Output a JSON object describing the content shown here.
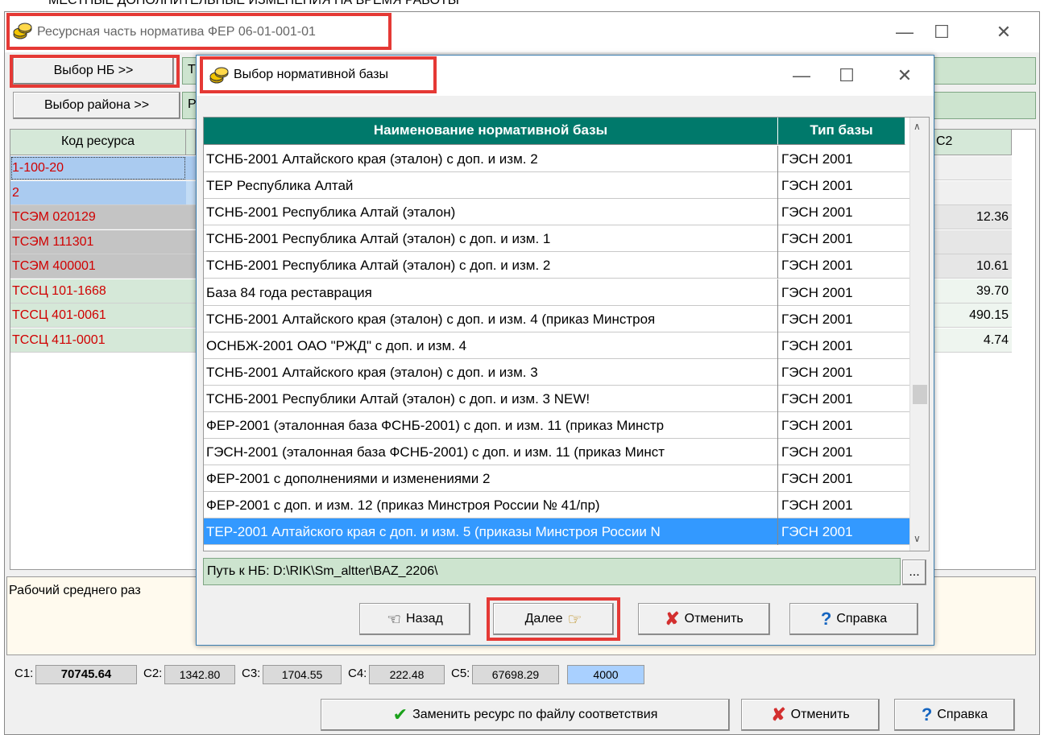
{
  "background_text": "МЕСТНЫЕ ДОПОЛНИТЕЛЬНЫЕ ИЗМЕНЕНИЯ НА ВРЕМЯ РАБОТЫ",
  "main_window": {
    "title": "Ресурсная часть норматива ФЕР 06-01-001-01",
    "btn_nb": "Выбор НБ >>",
    "field_nb_prefix": "Т",
    "btn_region": "Выбор района >>",
    "field_region_prefix": "Р",
    "grid": {
      "col_code": "Код ресурса",
      "col_c2": "С2",
      "rows": [
        {
          "code": "1-100-20",
          "c2": ""
        },
        {
          "code": "2",
          "c2": ""
        },
        {
          "code": "ТСЭМ 020129",
          "c2": "12.36"
        },
        {
          "code": "ТСЭМ 111301",
          "c2": ""
        },
        {
          "code": "ТСЭМ 400001",
          "c2": "10.61"
        },
        {
          "code": "ТССЦ 101-1668",
          "c2": "39.70"
        },
        {
          "code": "ТССЦ 401-0061",
          "c2": "490.15"
        },
        {
          "code": "ТССЦ 411-0001",
          "c2": "4.74"
        }
      ]
    },
    "description": "Рабочий среднего раз",
    "status": {
      "c1_label": "С1:",
      "c1": "70745.64",
      "c2_label": "С2:",
      "c2": "1342.80",
      "c3_label": "С3:",
      "c3": "1704.55",
      "c4_label": "С4:",
      "c4": "222.48",
      "c5_label": "С5:",
      "c5": "67698.29",
      "extra": "4000"
    },
    "btn_replace": "Заменить ресурс по файлу соответствия",
    "btn_cancel": "Отменить",
    "btn_help": "Справка"
  },
  "dialog": {
    "title": "Выбор нормативной базы",
    "col_name": "Наименование нормативной базы",
    "col_type": "Тип базы",
    "rows": [
      {
        "name": "ТСНБ-2001 Алтайского края (эталон) с доп. и изм. 2",
        "type": "ГЭСН 2001"
      },
      {
        "name": "ТЕР Республика Алтай",
        "type": "ГЭСН 2001"
      },
      {
        "name": "ТСНБ-2001 Республика Алтай (эталон)",
        "type": "ГЭСН 2001"
      },
      {
        "name": "ТСНБ-2001 Республика Алтай (эталон) с доп. и изм. 1",
        "type": "ГЭСН 2001"
      },
      {
        "name": "ТСНБ-2001 Республика Алтай (эталон) с доп. и изм. 2",
        "type": "ГЭСН 2001"
      },
      {
        "name": "База 84 года реставрация",
        "type": "ГЭСН 2001"
      },
      {
        "name": "ТСНБ-2001 Алтайского края (эталон) с доп. и изм. 4 (приказ Минстроя",
        "type": "ГЭСН 2001"
      },
      {
        "name": "ОСНБЖ-2001 ОАО \"РЖД\" с доп. и изм. 4",
        "type": "ГЭСН 2001"
      },
      {
        "name": "ТСНБ-2001 Алтайского края (эталон) с доп. и изм. 3",
        "type": "ГЭСН 2001"
      },
      {
        "name": "ТСНБ-2001 Республики Алтай (эталон) с доп. и изм. 3 NEW!",
        "type": "ГЭСН 2001"
      },
      {
        "name": "ФЕР-2001 (эталонная база ФСНБ-2001) с доп. и изм. 11 (приказ Минстр",
        "type": "ГЭСН 2001"
      },
      {
        "name": "ГЭСН-2001 (эталонная база ФСНБ-2001) с доп. и изм. 11 (приказ Минст",
        "type": "ГЭСН 2001"
      },
      {
        "name": "ФЕР-2001 с дополнениями и изменениями 2",
        "type": "ГЭСН 2001"
      },
      {
        "name": "ФЕР-2001 с доп. и изм. 12 (приказ Минстроя России № 41/пр)",
        "type": "ГЭСН 2001"
      },
      {
        "name": "ТЕР-2001 Алтайского края с доп. и изм. 5 (приказы Минстроя России N",
        "type": "ГЭСН 2001"
      }
    ],
    "path": "Путь к НБ: D:\\RIK\\Sm_altter\\BAZ_2206\\",
    "browse": "...",
    "btn_back": "Назад",
    "btn_next": "Далее",
    "btn_cancel": "Отменить",
    "btn_help": "Справка"
  }
}
